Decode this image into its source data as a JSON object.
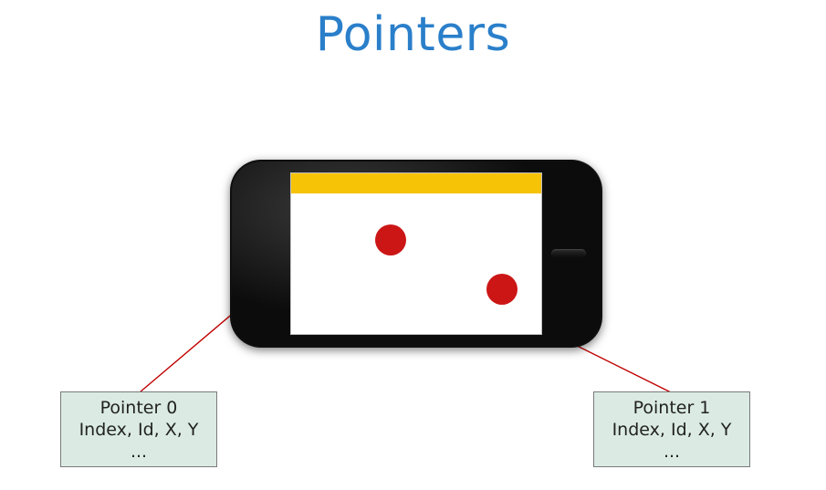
{
  "title": "Pointers",
  "pointers": [
    {
      "name": "Pointer 0",
      "fields": "Index, Id, X, Y",
      "more": "..."
    },
    {
      "name": "Pointer 1",
      "fields": "Index, Id, X, Y",
      "more": "..."
    }
  ]
}
